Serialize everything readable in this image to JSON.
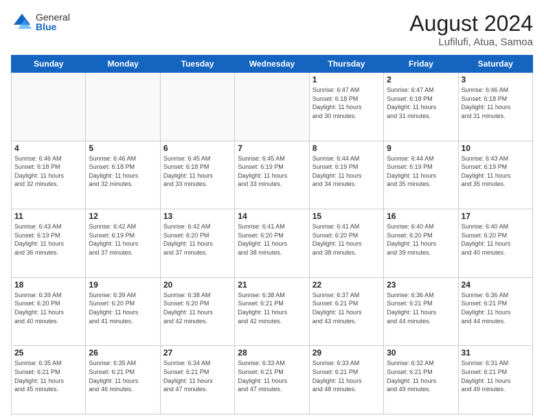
{
  "logo": {
    "general": "General",
    "blue": "Blue"
  },
  "title": {
    "month_year": "August 2024",
    "location": "Lufilufi, Atua, Samoa"
  },
  "days_of_week": [
    "Sunday",
    "Monday",
    "Tuesday",
    "Wednesday",
    "Thursday",
    "Friday",
    "Saturday"
  ],
  "weeks": [
    [
      {
        "num": "",
        "info": ""
      },
      {
        "num": "",
        "info": ""
      },
      {
        "num": "",
        "info": ""
      },
      {
        "num": "",
        "info": ""
      },
      {
        "num": "1",
        "info": "Sunrise: 6:47 AM\nSunset: 6:18 PM\nDaylight: 11 hours\nand 30 minutes."
      },
      {
        "num": "2",
        "info": "Sunrise: 6:47 AM\nSunset: 6:18 PM\nDaylight: 11 hours\nand 31 minutes."
      },
      {
        "num": "3",
        "info": "Sunrise: 6:46 AM\nSunset: 6:18 PM\nDaylight: 11 hours\nand 31 minutes."
      }
    ],
    [
      {
        "num": "4",
        "info": "Sunrise: 6:46 AM\nSunset: 6:18 PM\nDaylight: 11 hours\nand 32 minutes."
      },
      {
        "num": "5",
        "info": "Sunrise: 6:46 AM\nSunset: 6:18 PM\nDaylight: 11 hours\nand 32 minutes."
      },
      {
        "num": "6",
        "info": "Sunrise: 6:45 AM\nSunset: 6:18 PM\nDaylight: 11 hours\nand 33 minutes."
      },
      {
        "num": "7",
        "info": "Sunrise: 6:45 AM\nSunset: 6:19 PM\nDaylight: 11 hours\nand 33 minutes."
      },
      {
        "num": "8",
        "info": "Sunrise: 6:44 AM\nSunset: 6:19 PM\nDaylight: 11 hours\nand 34 minutes."
      },
      {
        "num": "9",
        "info": "Sunrise: 6:44 AM\nSunset: 6:19 PM\nDaylight: 11 hours\nand 35 minutes."
      },
      {
        "num": "10",
        "info": "Sunrise: 6:43 AM\nSunset: 6:19 PM\nDaylight: 11 hours\nand 35 minutes."
      }
    ],
    [
      {
        "num": "11",
        "info": "Sunrise: 6:43 AM\nSunset: 6:19 PM\nDaylight: 11 hours\nand 36 minutes."
      },
      {
        "num": "12",
        "info": "Sunrise: 6:42 AM\nSunset: 6:19 PM\nDaylight: 11 hours\nand 37 minutes."
      },
      {
        "num": "13",
        "info": "Sunrise: 6:42 AM\nSunset: 6:20 PM\nDaylight: 11 hours\nand 37 minutes."
      },
      {
        "num": "14",
        "info": "Sunrise: 6:41 AM\nSunset: 6:20 PM\nDaylight: 11 hours\nand 38 minutes."
      },
      {
        "num": "15",
        "info": "Sunrise: 6:41 AM\nSunset: 6:20 PM\nDaylight: 11 hours\nand 38 minutes."
      },
      {
        "num": "16",
        "info": "Sunrise: 6:40 AM\nSunset: 6:20 PM\nDaylight: 11 hours\nand 39 minutes."
      },
      {
        "num": "17",
        "info": "Sunrise: 6:40 AM\nSunset: 6:20 PM\nDaylight: 11 hours\nand 40 minutes."
      }
    ],
    [
      {
        "num": "18",
        "info": "Sunrise: 6:39 AM\nSunset: 6:20 PM\nDaylight: 11 hours\nand 40 minutes."
      },
      {
        "num": "19",
        "info": "Sunrise: 6:39 AM\nSunset: 6:20 PM\nDaylight: 11 hours\nand 41 minutes."
      },
      {
        "num": "20",
        "info": "Sunrise: 6:38 AM\nSunset: 6:20 PM\nDaylight: 11 hours\nand 42 minutes."
      },
      {
        "num": "21",
        "info": "Sunrise: 6:38 AM\nSunset: 6:21 PM\nDaylight: 11 hours\nand 42 minutes."
      },
      {
        "num": "22",
        "info": "Sunrise: 6:37 AM\nSunset: 6:21 PM\nDaylight: 11 hours\nand 43 minutes."
      },
      {
        "num": "23",
        "info": "Sunrise: 6:36 AM\nSunset: 6:21 PM\nDaylight: 11 hours\nand 44 minutes."
      },
      {
        "num": "24",
        "info": "Sunrise: 6:36 AM\nSunset: 6:21 PM\nDaylight: 11 hours\nand 44 minutes."
      }
    ],
    [
      {
        "num": "25",
        "info": "Sunrise: 6:35 AM\nSunset: 6:21 PM\nDaylight: 11 hours\nand 45 minutes."
      },
      {
        "num": "26",
        "info": "Sunrise: 6:35 AM\nSunset: 6:21 PM\nDaylight: 11 hours\nand 46 minutes."
      },
      {
        "num": "27",
        "info": "Sunrise: 6:34 AM\nSunset: 6:21 PM\nDaylight: 11 hours\nand 47 minutes."
      },
      {
        "num": "28",
        "info": "Sunrise: 6:33 AM\nSunset: 6:21 PM\nDaylight: 11 hours\nand 47 minutes."
      },
      {
        "num": "29",
        "info": "Sunrise: 6:33 AM\nSunset: 6:21 PM\nDaylight: 11 hours\nand 48 minutes."
      },
      {
        "num": "30",
        "info": "Sunrise: 6:32 AM\nSunset: 6:21 PM\nDaylight: 11 hours\nand 49 minutes."
      },
      {
        "num": "31",
        "info": "Sunrise: 6:31 AM\nSunset: 6:21 PM\nDaylight: 11 hours\nand 49 minutes."
      }
    ]
  ]
}
